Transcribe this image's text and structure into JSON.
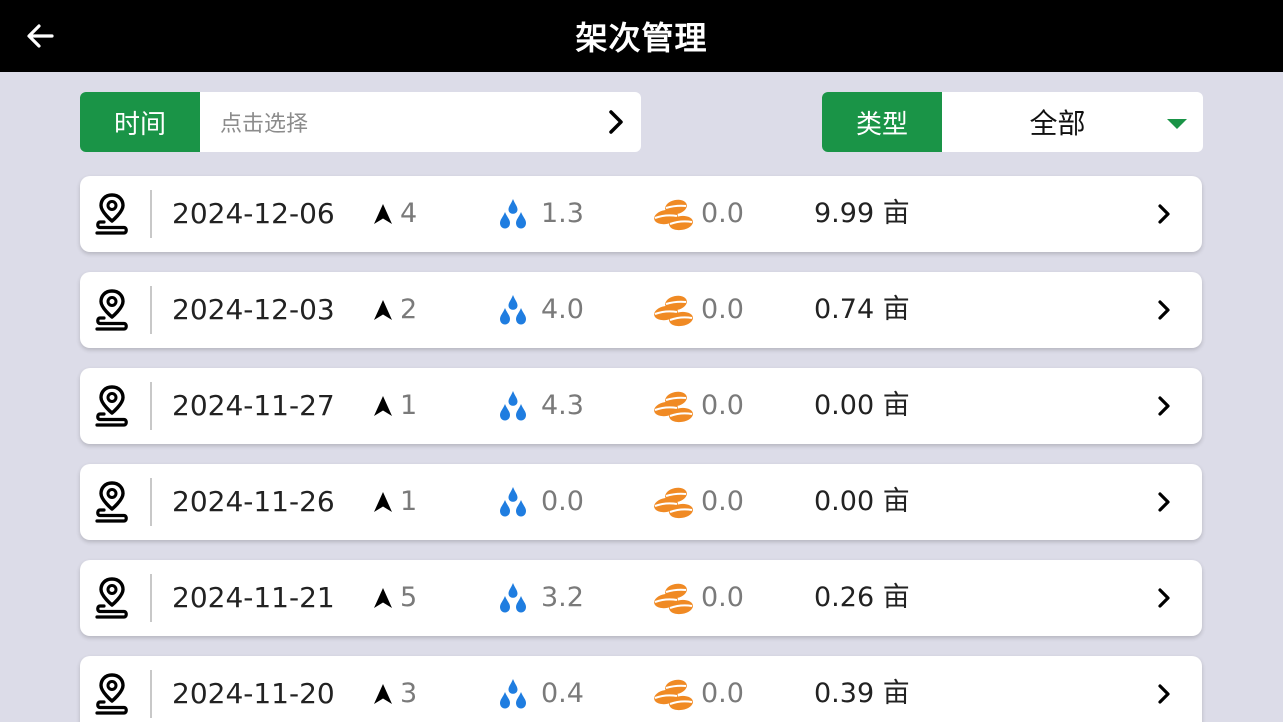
{
  "header": {
    "title": "架次管理"
  },
  "filters": {
    "time_label": "时间",
    "time_placeholder": "点击选择",
    "type_label": "类型",
    "type_value": "全部"
  },
  "colors": {
    "accent": "#1a9447",
    "header_bg": "#000000",
    "page_bg": "#dcdce8",
    "drop": "#1f7de0",
    "seed": "#f08a24"
  },
  "icons": {
    "back": "back-arrow-icon",
    "time_next": "chevron-right-icon",
    "type_dropdown": "caret-down-icon",
    "row_pin": "map-pin-icon",
    "row_flights": "navigation-arrow-icon",
    "row_spray": "water-drops-icon",
    "row_seed": "seeds-icon",
    "row_next": "chevron-right-icon"
  },
  "records": [
    {
      "date": "2024-12-06",
      "flights": "4",
      "spray": "1.3",
      "seed": "0.0",
      "area": "9.99 亩"
    },
    {
      "date": "2024-12-03",
      "flights": "2",
      "spray": "4.0",
      "seed": "0.0",
      "area": "0.74 亩"
    },
    {
      "date": "2024-11-27",
      "flights": "1",
      "spray": "4.3",
      "seed": "0.0",
      "area": "0.00 亩"
    },
    {
      "date": "2024-11-26",
      "flights": "1",
      "spray": "0.0",
      "seed": "0.0",
      "area": "0.00 亩"
    },
    {
      "date": "2024-11-21",
      "flights": "5",
      "spray": "3.2",
      "seed": "0.0",
      "area": "0.26 亩"
    },
    {
      "date": "2024-11-20",
      "flights": "3",
      "spray": "0.4",
      "seed": "0.0",
      "area": "0.39 亩"
    }
  ]
}
